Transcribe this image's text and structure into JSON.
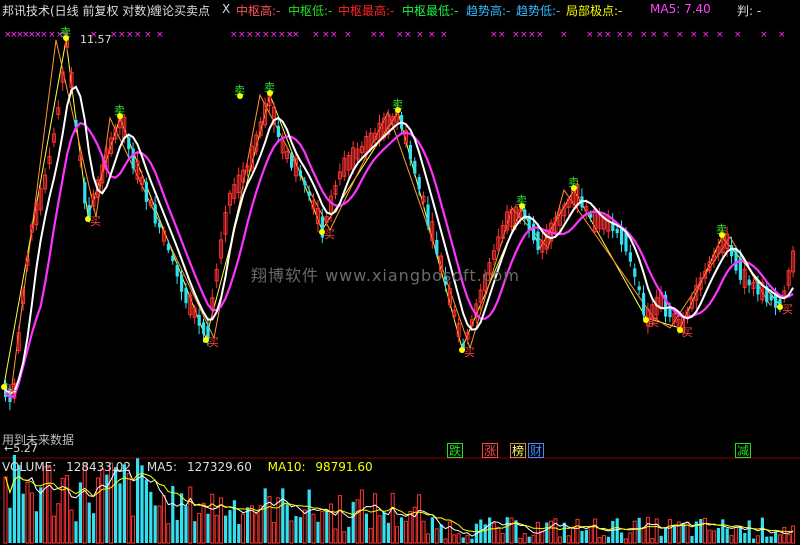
{
  "header": {
    "title": "邦讯技术(日线 前复权 对数)",
    "indicator": "缠论买卖点",
    "close_glyph": "X",
    "items": [
      {
        "label": "中枢高:",
        "value": "-",
        "color": "#ff5555"
      },
      {
        "label": "中枢低:",
        "value": "-",
        "color": "#22dd22"
      },
      {
        "label": "中枢最高:",
        "value": "-",
        "color": "#ff2222"
      },
      {
        "label": "中枢最低:",
        "value": "-",
        "color": "#22ee44"
      },
      {
        "label": "趋势高:",
        "value": "-",
        "color": "#33bbff"
      },
      {
        "label": "趋势低:",
        "value": "-",
        "color": "#33bbff"
      },
      {
        "label": "局部极点:",
        "value": "-",
        "color": "#ffff00"
      },
      {
        "label": "MA5:",
        "value": "7.40",
        "color": "#ff44ff"
      },
      {
        "label": "判:",
        "value": "-",
        "color": "#dddddd"
      }
    ]
  },
  "price_panel": {
    "high_label": "11.57",
    "low_label": "5.27",
    "future_data_note": "用到未来数据",
    "watermark": "翔博软件  www.xiangbosoft.com",
    "sell_glyph": "卖",
    "buy_glyph": "买"
  },
  "signals": [
    {
      "label": "跌",
      "color": "#22dd22",
      "border": "#22dd22"
    },
    {
      "label": "涨",
      "color": "#ff4444",
      "border": "#ff4444"
    },
    {
      "label": "榜",
      "color": "#ffff66",
      "border": "#cc8844"
    },
    {
      "label": "财",
      "color": "#4488ff",
      "border": "#4488ff"
    },
    {
      "label": "减",
      "color": "#22dd22",
      "border": "#22dd22"
    }
  ],
  "volume_panel": {
    "volume": {
      "label": "VOLUME:",
      "value": "128433.02",
      "color": "#dddddd"
    },
    "ma5": {
      "label": "MA5:",
      "value": "127329.60",
      "color": "#dddddd"
    },
    "ma10": {
      "label": "MA10:",
      "value": "98791.60",
      "color": "#ffff00"
    }
  },
  "colors": {
    "up": "#ff3333",
    "down": "#33e0f0",
    "ma_pink": "#ff33ff",
    "ma_white": "#ffffff",
    "zigzag_yellow": "#ffff44",
    "zigzag_orange": "#ff9933",
    "marker_magenta": "#ff33ff"
  }
}
